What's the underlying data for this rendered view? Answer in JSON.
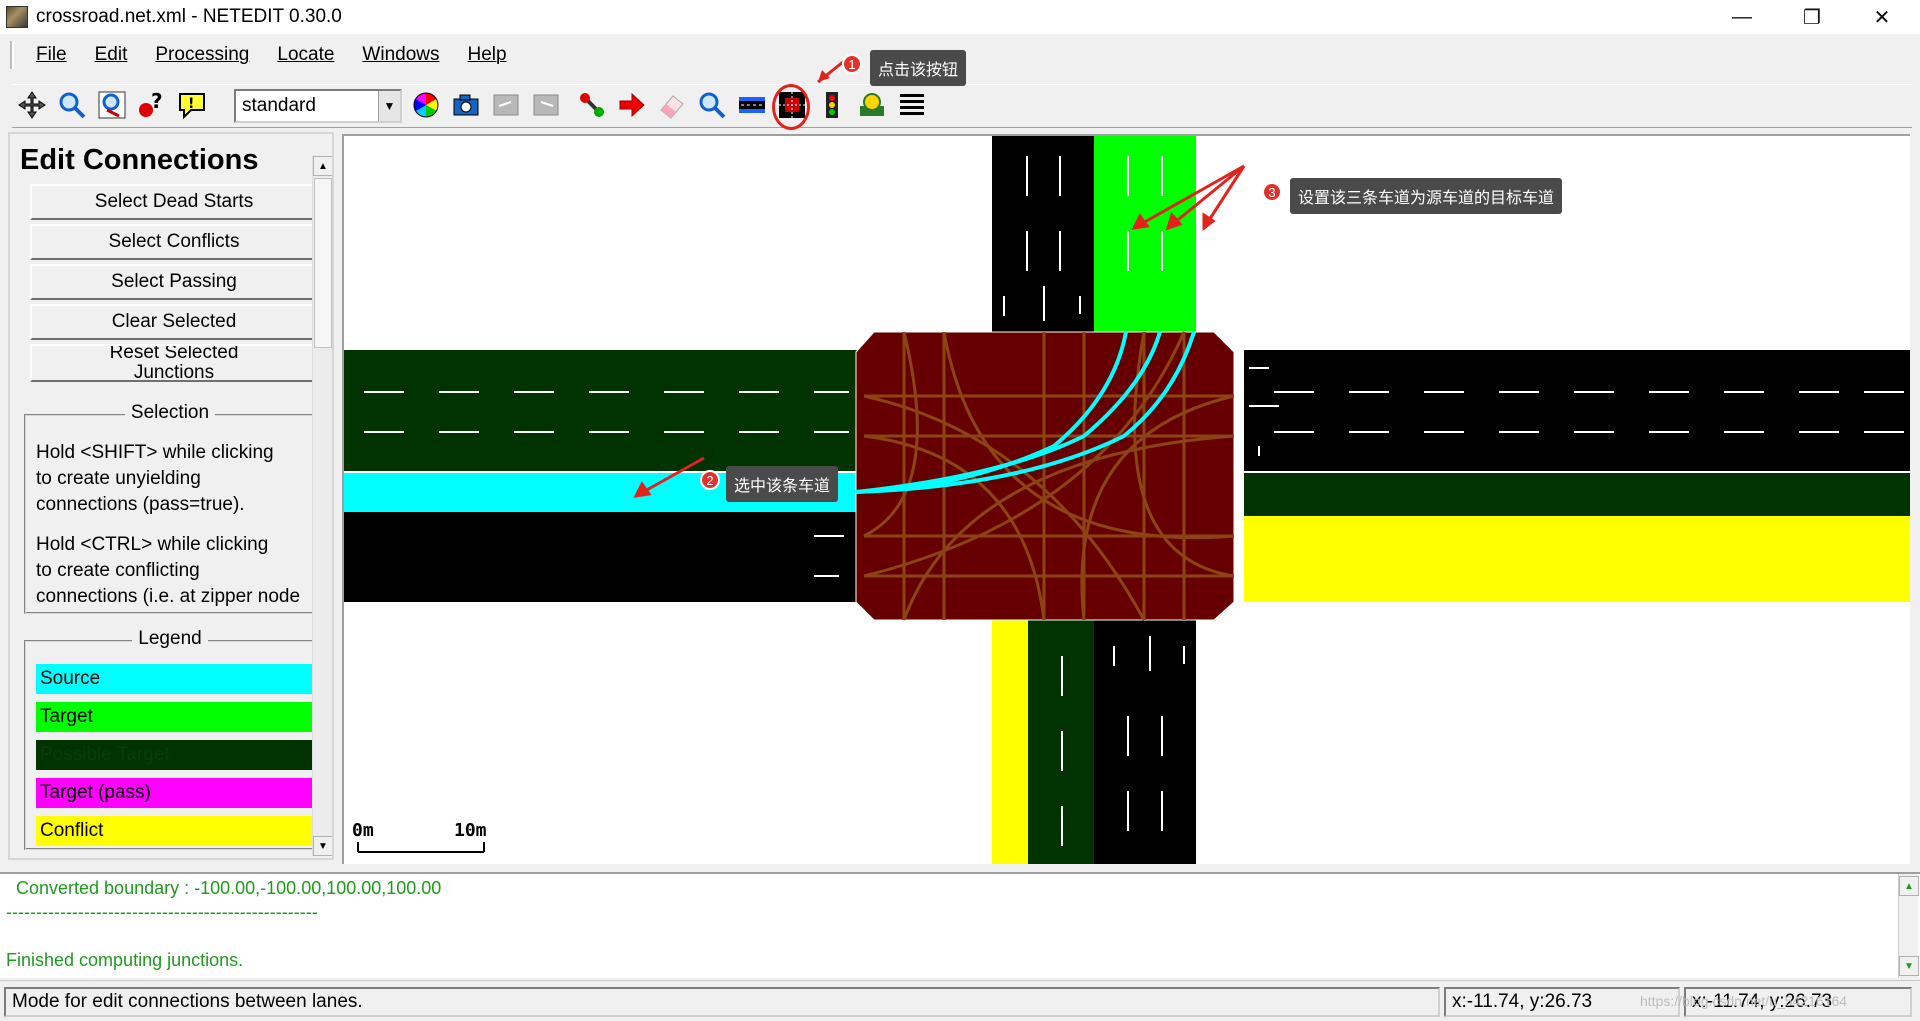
{
  "window": {
    "title": "crossroad.net.xml - NETEDIT 0.30.0",
    "minimize_glyph": "—",
    "restore_glyph": "❐",
    "close_glyph": "✕"
  },
  "menu": [
    "File",
    "Edit",
    "Processing",
    "Locate",
    "Windows",
    "Help"
  ],
  "toolbar": {
    "scheme_value": "standard",
    "icons": [
      "recenter-view-icon",
      "zoom-icon",
      "locate-junction-icon",
      "locate-edge-icon",
      "locate-poi-icon",
      "color-wheel-icon",
      "screenshot-icon",
      "undo-icon",
      "redo-icon",
      "create-edge-icon",
      "move-icon",
      "delete-icon",
      "inspect-icon",
      "select-icon",
      "connect-mode-icon",
      "traffic-light-icon",
      "additional-icon",
      "crossing-icon"
    ]
  },
  "panel": {
    "title": "Edit Connections",
    "buttons": [
      "Select Dead Starts",
      "Select Conflicts",
      "Select Passing",
      "Clear Selected",
      "Reset Selected",
      "Junctions"
    ],
    "selection_label": "Selection",
    "selection_text_1": [
      "Hold <SHIFT> while clicking",
      "to create unyielding",
      "connections (pass=true)."
    ],
    "selection_text_2": [
      "Hold <CTRL> while clicking",
      "to create conflicting",
      "connections (i.e. at zipper node"
    ],
    "legend_label": "Legend",
    "legend": [
      {
        "label": "Source",
        "color": "#00ffff"
      },
      {
        "label": "Target",
        "color": "#00ff00"
      },
      {
        "label": "Possible Target",
        "color": "#003300"
      },
      {
        "label": "Target (pass)",
        "color": "#ff00ff"
      },
      {
        "label": "Conflict",
        "color": "#ffff00"
      }
    ]
  },
  "canvas": {
    "scale_start": "0m",
    "scale_end": "10m",
    "colors": {
      "road": "#000000",
      "source": "#00ffff",
      "target": "#00ff00",
      "possible_target": "#003300",
      "conflict": "#ffff00",
      "junction": "#660000",
      "link": "#8b4513"
    }
  },
  "messages": {
    "line1": "Converted boundary : -100.00,-100.00,100.00,100.00",
    "line2": "----------------------------------------------------",
    "line3": "Finished computing junctions."
  },
  "status": {
    "mode": "Mode for edit connections between lanes.",
    "coord1": "x:-11.74, y:26.73",
    "coord2": "x:-11.74, y:26.73",
    "watermark": "https://blog.csdn.net/u_54216164"
  },
  "annotations": {
    "a1_num": "1",
    "a1_text": "点击该按钮",
    "a2_num": "2",
    "a2_text": "选中该条车道",
    "a3_num": "3",
    "a3_text": "设置该三条车道为源车道的目标车道"
  }
}
